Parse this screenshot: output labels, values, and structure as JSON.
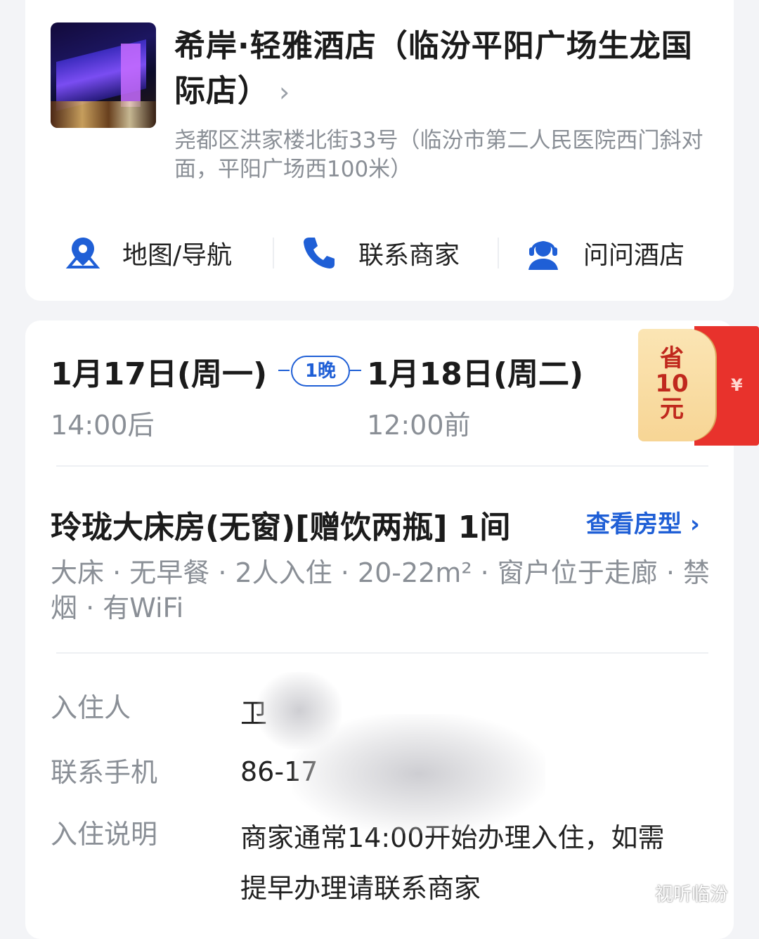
{
  "hotel": {
    "name": "希岸·轻雅酒店（临汾平阳广场生龙国际店）",
    "address": "尧都区洪家楼北街33号（临汾市第二人民医院西门斜对面，平阳广场西100米）",
    "thumbnail_icon": "hotel-photo"
  },
  "actions": [
    {
      "label": "地图/导航",
      "icon": "map-pin-icon"
    },
    {
      "label": "联系商家",
      "icon": "phone-icon"
    },
    {
      "label": "问问酒店",
      "icon": "customer-service-icon"
    }
  ],
  "booking": {
    "checkin_date": "1月17日(周一)",
    "checkin_time": "14:00后",
    "nights": "1晚",
    "checkout_date": "1月18日(周二)",
    "checkout_time": "12:00前",
    "coupon": {
      "line1": "省",
      "line2": "10",
      "line3": "元",
      "symbol": "¥"
    },
    "room_title": "玲珑大床房(无窗)[赠饮两瓶] 1间",
    "room_link": "查看房型",
    "room_desc": "大床 · 无早餐 · 2人入住 · 20-22m² · 窗户位于走廊 · 禁烟 · 有WiFi",
    "guest_label": "入住人",
    "guest_value": "卫",
    "phone_label": "联系手机",
    "phone_value": "86-17",
    "notice_label": "入住说明",
    "notice_value": "商家通常14:00开始办理入住，如需提早办理请联系商家"
  },
  "watermark": "视听临汾",
  "colors": {
    "accent": "#1f5fd6",
    "coupon_red": "#e8322c",
    "muted": "#8a8f96"
  }
}
